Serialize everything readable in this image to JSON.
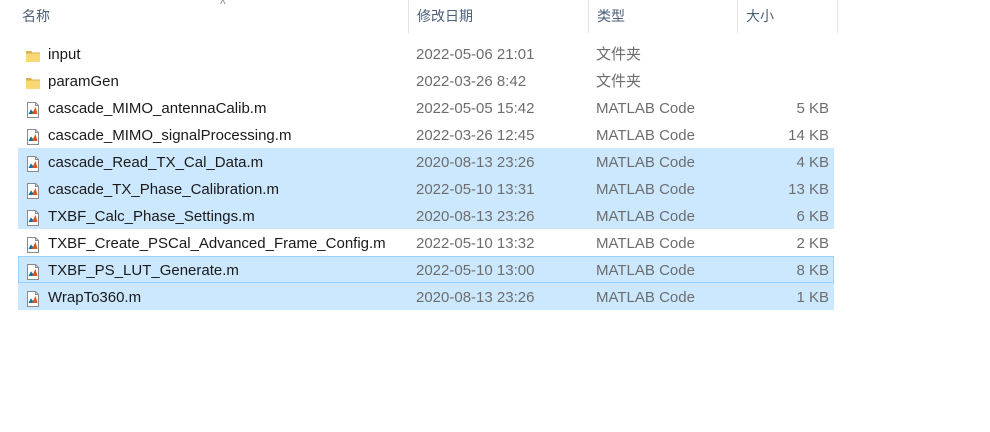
{
  "columns": {
    "name": "名称",
    "date": "修改日期",
    "type": "类型",
    "size": "大小",
    "sort_arrow": "^"
  },
  "files": [
    {
      "name": "input",
      "date": "2022-05-06 21:01",
      "type": "文件夹",
      "size": "",
      "icon": "folder-icon",
      "selected": false
    },
    {
      "name": "paramGen",
      "date": "2022-03-26 8:42",
      "type": "文件夹",
      "size": "",
      "icon": "folder-icon",
      "selected": false
    },
    {
      "name": "cascade_MIMO_antennaCalib.m",
      "date": "2022-05-05 15:42",
      "type": "MATLAB Code",
      "size": "5 KB",
      "icon": "matlab-file-icon",
      "selected": false
    },
    {
      "name": "cascade_MIMO_signalProcessing.m",
      "date": "2022-03-26 12:45",
      "type": "MATLAB Code",
      "size": "14 KB",
      "icon": "matlab-file-icon",
      "selected": false
    },
    {
      "name": "cascade_Read_TX_Cal_Data.m",
      "date": "2020-08-13 23:26",
      "type": "MATLAB Code",
      "size": "4 KB",
      "icon": "matlab-file-icon",
      "selected": true
    },
    {
      "name": "cascade_TX_Phase_Calibration.m",
      "date": "2022-05-10 13:31",
      "type": "MATLAB Code",
      "size": "13 KB",
      "icon": "matlab-file-icon",
      "selected": true
    },
    {
      "name": "TXBF_Calc_Phase_Settings.m",
      "date": "2020-08-13 23:26",
      "type": "MATLAB Code",
      "size": "6 KB",
      "icon": "matlab-file-icon",
      "selected": true
    },
    {
      "name": "TXBF_Create_PSCal_Advanced_Frame_Config.m",
      "date": "2022-05-10 13:32",
      "type": "MATLAB Code",
      "size": "2 KB",
      "icon": "matlab-file-icon",
      "selected": false
    },
    {
      "name": "TXBF_PS_LUT_Generate.m",
      "date": "2022-05-10 13:00",
      "type": "MATLAB Code",
      "size": "8 KB",
      "icon": "matlab-file-icon",
      "selected": true,
      "focused": true
    },
    {
      "name": "WrapTo360.m",
      "date": "2020-08-13 23:26",
      "type": "MATLAB Code",
      "size": "1 KB",
      "icon": "matlab-file-icon",
      "selected": true
    }
  ]
}
